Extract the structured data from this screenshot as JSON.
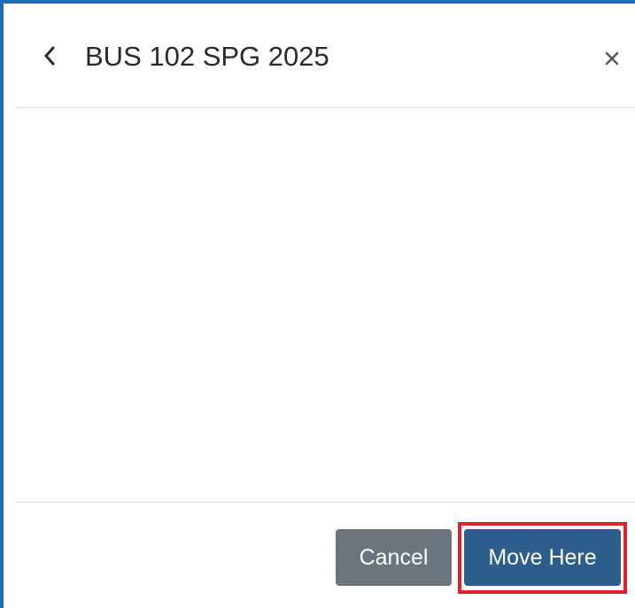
{
  "dialog": {
    "title": "BUS 102 SPG 2025",
    "back_icon": "chevron-left-icon",
    "close_icon": "close-icon"
  },
  "footer": {
    "cancel_label": "Cancel",
    "move_here_label": "Move Here"
  },
  "colors": {
    "frame_border": "#1f6fb8",
    "cancel_bg": "#6b757d",
    "move_here_bg": "#2c5e8c",
    "highlight": "#e41e2a"
  }
}
